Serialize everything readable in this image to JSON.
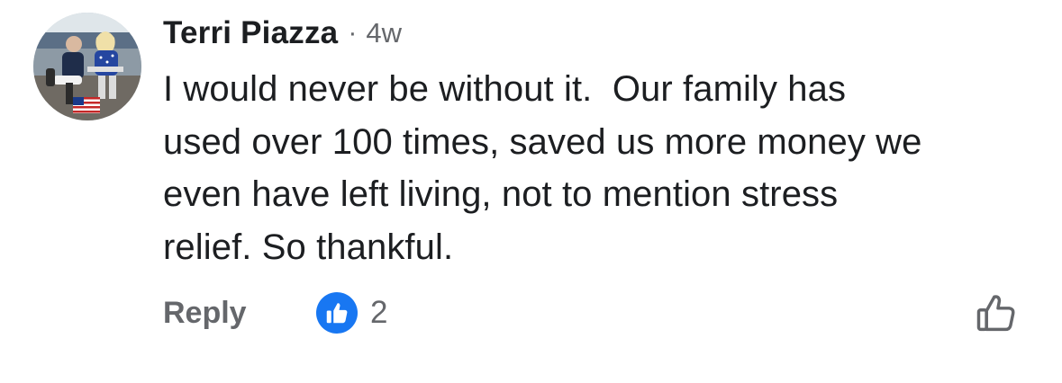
{
  "comment": {
    "author": "Terri Piazza",
    "separator": "·",
    "timestamp": "4w",
    "text": "I would never be without it.  Our family has\nused over 100 times, saved us more money we\neven have left living, not to mention stress\nrelief. So thankful.",
    "avatar_icon": "user-avatar-photo"
  },
  "actions": {
    "reply_label": "Reply",
    "reaction_icon": "thumbs-up-reaction-icon",
    "reaction_count": "2",
    "like_icon": "thumbs-up-outline-icon"
  },
  "colors": {
    "text_primary": "#1c1e21",
    "text_secondary": "#65676b",
    "like_blue": "#1877f2"
  }
}
